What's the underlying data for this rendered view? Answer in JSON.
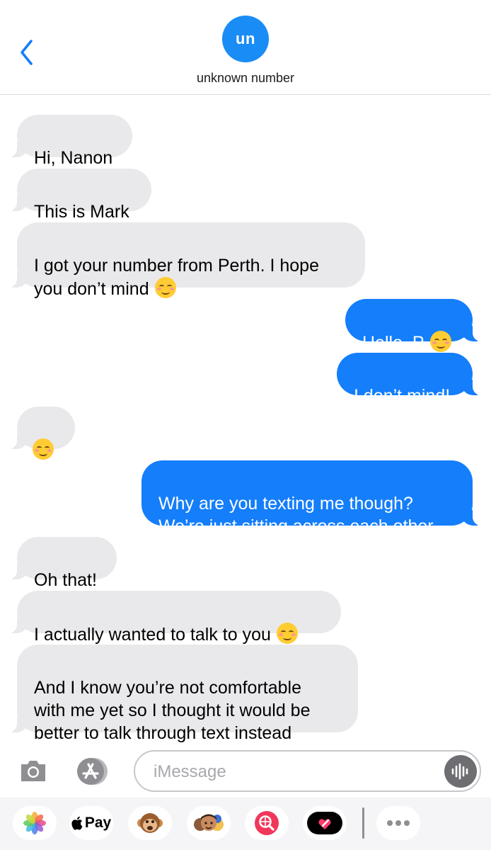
{
  "header": {
    "avatar_initials": "un",
    "contact_name": "unknown number",
    "accent_color": "#1a8cf5"
  },
  "messages": [
    {
      "direction": "incoming",
      "text": "Hi, Nanon",
      "emoji": ""
    },
    {
      "direction": "incoming",
      "text": "This is Mark",
      "emoji": ""
    },
    {
      "direction": "incoming",
      "text": "I got your number from Perth. I hope\nyou don’t mind",
      "emoji": "smiling-face-emoji"
    },
    {
      "direction": "outgoing",
      "text": "Hello, P",
      "emoji": "smiling-face-emoji"
    },
    {
      "direction": "outgoing",
      "text": "I don’t mind!",
      "emoji": ""
    },
    {
      "direction": "incoming",
      "text": "",
      "emoji": "smiling-face-emoji"
    },
    {
      "direction": "outgoing",
      "text": "Why are you texting me though?\nWe’re just sitting across each other",
      "emoji": ""
    },
    {
      "direction": "incoming",
      "text": "Oh that!",
      "emoji": ""
    },
    {
      "direction": "incoming",
      "text": "I actually wanted to talk to you",
      "emoji": "smiling-face-emoji"
    },
    {
      "direction": "incoming",
      "text": "And I know you’re not comfortable\nwith me yet so I thought it would be\nbetter to talk through text instead",
      "emoji": ""
    }
  ],
  "composer": {
    "placeholder": "iMessage",
    "value": ""
  },
  "drawer": {
    "apps": [
      {
        "name": "photos-app-icon"
      },
      {
        "name": "apple-pay-app",
        "label": "Pay"
      },
      {
        "name": "animoji-monkey-icon"
      },
      {
        "name": "memoji-stickers-icon"
      },
      {
        "name": "web-image-search-icon"
      },
      {
        "name": "digital-touch-icon"
      },
      {
        "name": "more-apps-icon"
      }
    ]
  },
  "colors": {
    "incoming_bubble": "#e9e9eb",
    "outgoing_bubble": "#147efb"
  }
}
